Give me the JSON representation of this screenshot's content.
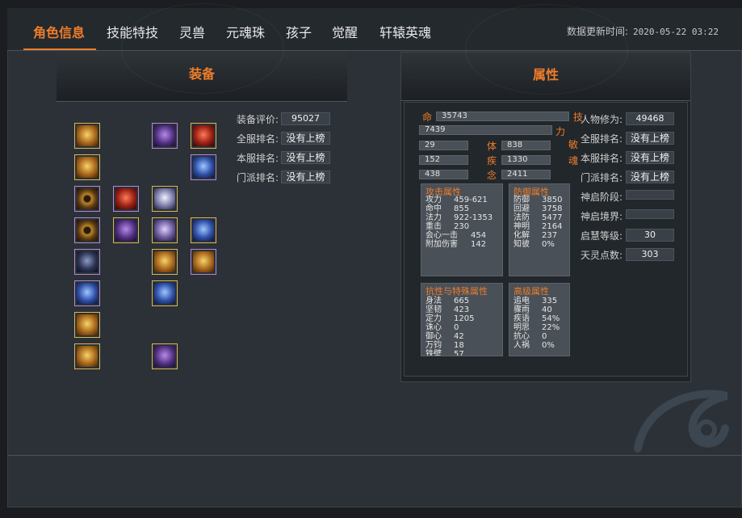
{
  "nav": {
    "tabs": [
      "角色信息",
      "技能特技",
      "灵兽",
      "元魂珠",
      "孩子",
      "觉醒",
      "轩辕英魂"
    ],
    "update_label": "数据更新时间:",
    "update_time": "2020-05-22 03:22"
  },
  "equip": {
    "title": "装备",
    "score_label": "装备评价:",
    "score_value": "95027",
    "server_all_label": "全服排名:",
    "server_all_value": "没有上榜",
    "server_label": "本服排名:",
    "server_value": "没有上榜",
    "sect_label": "门派排名:",
    "sect_value": "没有上榜"
  },
  "attrs": {
    "title": "属性",
    "ming_char": "命",
    "ming_value": "35743",
    "ji_char": "技",
    "li_value": "7439",
    "li_char": "力",
    "min_char": "敏",
    "r3_left": "29",
    "ti_char": "体",
    "r3_right": "838",
    "r4_left": "152",
    "ji2_char": "疾",
    "r4_right": "1330",
    "hun_char": "魂",
    "r5_left": "438",
    "nian_char": "念",
    "r5_right": "2411",
    "cultivation_label": "人物修为:",
    "cultivation_value": "49468",
    "all_rank_label": "全服排名:",
    "all_rank_value": "没有上榜",
    "server_rank_label": "本服排名:",
    "server_rank_value": "没有上榜",
    "sect_rank_label": "门派排名:",
    "sect_rank_value": "没有上榜",
    "shenqi_stage_label": "神启阶段:",
    "shenqi_stage_value": "",
    "shenqi_realm_label": "神启境界:",
    "shenqi_realm_value": "",
    "qihui_label": "启慧等级:",
    "qihui_value": "30",
    "tianling_label": "天灵点数:",
    "tianling_value": "303"
  },
  "attack": {
    "title": "攻击属性",
    "rows": [
      {
        "k": "攻力",
        "v": "459-621"
      },
      {
        "k": "命中",
        "v": "855"
      },
      {
        "k": "法力",
        "v": "922-1353"
      },
      {
        "k": "重击",
        "v": "230"
      },
      {
        "k": "会心一击",
        "v": "454"
      },
      {
        "k": "附加伤害",
        "v": "142"
      }
    ]
  },
  "defense": {
    "title": "防御属性",
    "rows": [
      {
        "k": "防御",
        "v": "3850"
      },
      {
        "k": "回避",
        "v": "3758"
      },
      {
        "k": "法防",
        "v": "5477"
      },
      {
        "k": "神明",
        "v": "2164"
      },
      {
        "k": "化解",
        "v": "237"
      },
      {
        "k": "知彼",
        "v": "0%"
      }
    ]
  },
  "resist": {
    "title": "抗性与特殊属性",
    "rows": [
      {
        "k": "身法",
        "v": "665"
      },
      {
        "k": "坚韧",
        "v": "423"
      },
      {
        "k": "定力",
        "v": "1205"
      },
      {
        "k": "诛心",
        "v": "0"
      },
      {
        "k": "御心",
        "v": "42"
      },
      {
        "k": "万钧",
        "v": "18"
      },
      {
        "k": "铁壁",
        "v": "57"
      }
    ]
  },
  "advanced": {
    "title": "高级属性",
    "rows": [
      {
        "k": "追电",
        "v": "335"
      },
      {
        "k": "骤雨",
        "v": "40"
      },
      {
        "k": "疾语",
        "v": "54%"
      },
      {
        "k": "明思",
        "v": "22%"
      },
      {
        "k": "抗心",
        "v": "0"
      },
      {
        "k": "人祸",
        "v": "0%"
      }
    ]
  },
  "slots": [
    {
      "icon": "gold-glove-icon"
    },
    {
      "icon": "purple-armor-icon"
    },
    {
      "icon": "red-gauntlet-icon"
    },
    {
      "icon": "gold-glove-icon"
    },
    {
      "icon": "blue-mage-figure-icon"
    },
    {
      "icon": "bronze-ring-icon"
    },
    {
      "icon": "red-demon-icon"
    },
    {
      "icon": "white-crown-icon"
    },
    {
      "icon": "bronze-ring-icon"
    },
    {
      "icon": "purple-claw-icon"
    },
    {
      "icon": "winged-figure-icon"
    },
    {
      "icon": "blue-orb-icon"
    },
    {
      "icon": "dark-ring-icon"
    },
    {
      "icon": "gold-figure-icon"
    },
    {
      "icon": "gold-wand-icon"
    },
    {
      "icon": "blue-bracelet-icon"
    },
    {
      "icon": "blue-boots-icon"
    },
    {
      "icon": "gold-necklace-icon"
    },
    {
      "icon": "gold-amulet-icon"
    },
    {
      "icon": "purple-cloak-icon"
    }
  ]
}
